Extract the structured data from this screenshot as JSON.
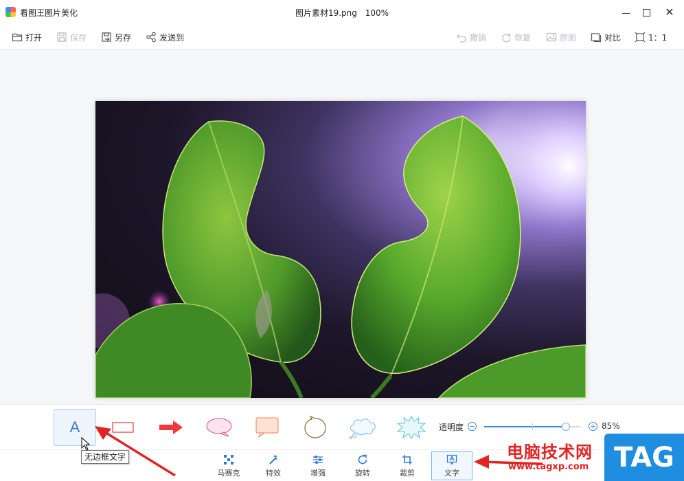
{
  "window": {
    "app_title": "看图王图片美化",
    "file_name": "图片素材19.png",
    "zoom": "100%",
    "controls": {
      "minimize": "minimize",
      "maximize": "maximize",
      "close": "✕"
    }
  },
  "toolbar": {
    "open": "打开",
    "save": "保存",
    "save_as": "另存",
    "send_to": "发送到",
    "undo": "撤销",
    "redo": "恢复",
    "original": "原图",
    "compare": "对比",
    "actual_size": "1：1"
  },
  "text_panel": {
    "styles": [
      {
        "id": "plain-text",
        "glyph": "A",
        "selected": true,
        "tooltip": "无边框文字"
      },
      {
        "id": "rectangle",
        "selected": false
      },
      {
        "id": "arrow",
        "selected": false
      },
      {
        "id": "ellipse-bubble",
        "selected": false
      },
      {
        "id": "speech-bubble",
        "selected": false
      },
      {
        "id": "thought-bubble",
        "selected": false
      },
      {
        "id": "cloud-bubble",
        "selected": false
      },
      {
        "id": "burst-bubble",
        "selected": false
      }
    ],
    "opacity_label": "透明度",
    "opacity_minus": "−",
    "opacity_plus": "+",
    "opacity_value": 0.85,
    "opacity_text": "85%"
  },
  "tools": [
    {
      "id": "mosaic",
      "label": "马赛克",
      "active": false
    },
    {
      "id": "effects",
      "label": "特效",
      "active": false
    },
    {
      "id": "enhance",
      "label": "增强",
      "active": false
    },
    {
      "id": "rotate",
      "label": "旋转",
      "active": false
    },
    {
      "id": "crop",
      "label": "裁剪",
      "active": false
    },
    {
      "id": "text",
      "label": "文字",
      "active": true
    }
  ],
  "tooltip": "无边框文字",
  "watermark": {
    "text": "电脑技术网",
    "url": "www.tagxp.com",
    "badge": "TAG"
  },
  "colors": {
    "accent": "#3a86e0",
    "annotation": "#e02424",
    "badge": "#1f8ee0"
  },
  "icons": {
    "open": "folder-icon",
    "save": "floppy-icon",
    "save_as": "save-as-icon",
    "send_to": "share-icon",
    "undo": "undo-icon",
    "redo": "redo-icon",
    "original": "image-icon",
    "compare": "compare-icon",
    "actual_size": "actual-size-icon"
  }
}
